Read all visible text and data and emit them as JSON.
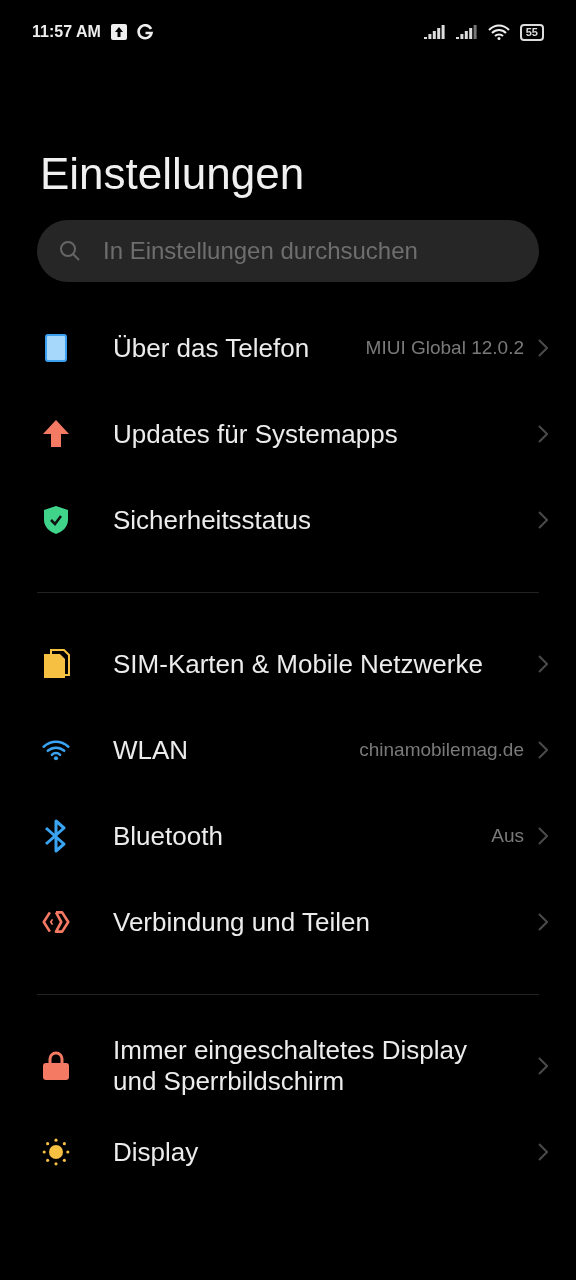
{
  "status_bar": {
    "time": "11:57 AM",
    "battery": "55"
  },
  "title": "Einstellungen",
  "search": {
    "placeholder": "In Einstellungen durchsuchen"
  },
  "groups": [
    {
      "items": [
        {
          "kind": "phone",
          "label": "Über das Telefon",
          "value": "MIUI Global 12.0.2"
        },
        {
          "kind": "update",
          "label": "Updates für Systemapps"
        },
        {
          "kind": "security",
          "label": "Sicherheitsstatus"
        }
      ]
    },
    {
      "items": [
        {
          "kind": "sim",
          "label": "SIM-Karten & Mobile Netzwerke"
        },
        {
          "kind": "wifi",
          "label": "WLAN",
          "value": "chinamobilemag.de"
        },
        {
          "kind": "bluetooth",
          "label": "Bluetooth",
          "value": "Aus"
        },
        {
          "kind": "share",
          "label": "Verbindung und Teilen"
        }
      ]
    },
    {
      "items": [
        {
          "kind": "lock",
          "label": "Immer eingeschaltetes Display und Sperrbildschirm"
        },
        {
          "kind": "display",
          "label": "Display"
        }
      ]
    }
  ]
}
